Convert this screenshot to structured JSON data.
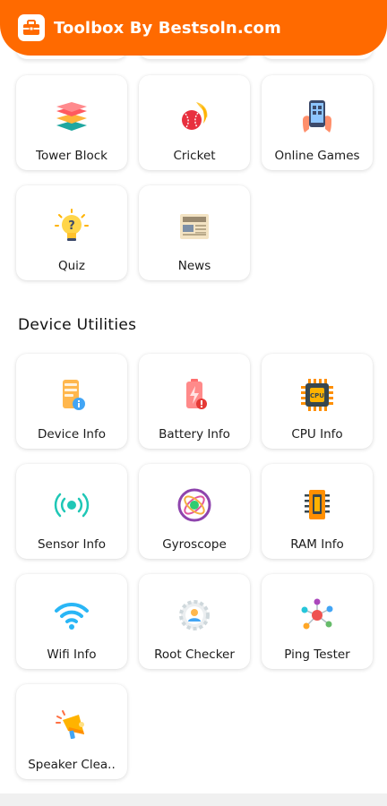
{
  "app": {
    "title": "Toolbox By Bestsoln.com",
    "accent_color": "#ff6a00"
  },
  "games": [
    {
      "label": "Tower Block",
      "icon": "tower-block-icon"
    },
    {
      "label": "Cricket",
      "icon": "cricket-icon"
    },
    {
      "label": "Online Games",
      "icon": "online-games-icon"
    },
    {
      "label": "Quiz",
      "icon": "quiz-icon"
    },
    {
      "label": "News",
      "icon": "news-icon"
    }
  ],
  "device_utilities": {
    "title": "Device Utilities",
    "items": [
      {
        "label": "Device Info",
        "icon": "device-info-icon"
      },
      {
        "label": "Battery Info",
        "icon": "battery-info-icon"
      },
      {
        "label": "CPU Info",
        "icon": "cpu-info-icon"
      },
      {
        "label": "Sensor Info",
        "icon": "sensor-info-icon"
      },
      {
        "label": "Gyroscope",
        "icon": "gyroscope-icon"
      },
      {
        "label": "RAM Info",
        "icon": "ram-info-icon"
      },
      {
        "label": "Wifi Info",
        "icon": "wifi-info-icon"
      },
      {
        "label": "Root Checker",
        "icon": "root-checker-icon"
      },
      {
        "label": "Ping Tester",
        "icon": "ping-tester-icon"
      },
      {
        "label": "Speaker Clea..",
        "icon": "speaker-cleaner-icon"
      }
    ]
  }
}
